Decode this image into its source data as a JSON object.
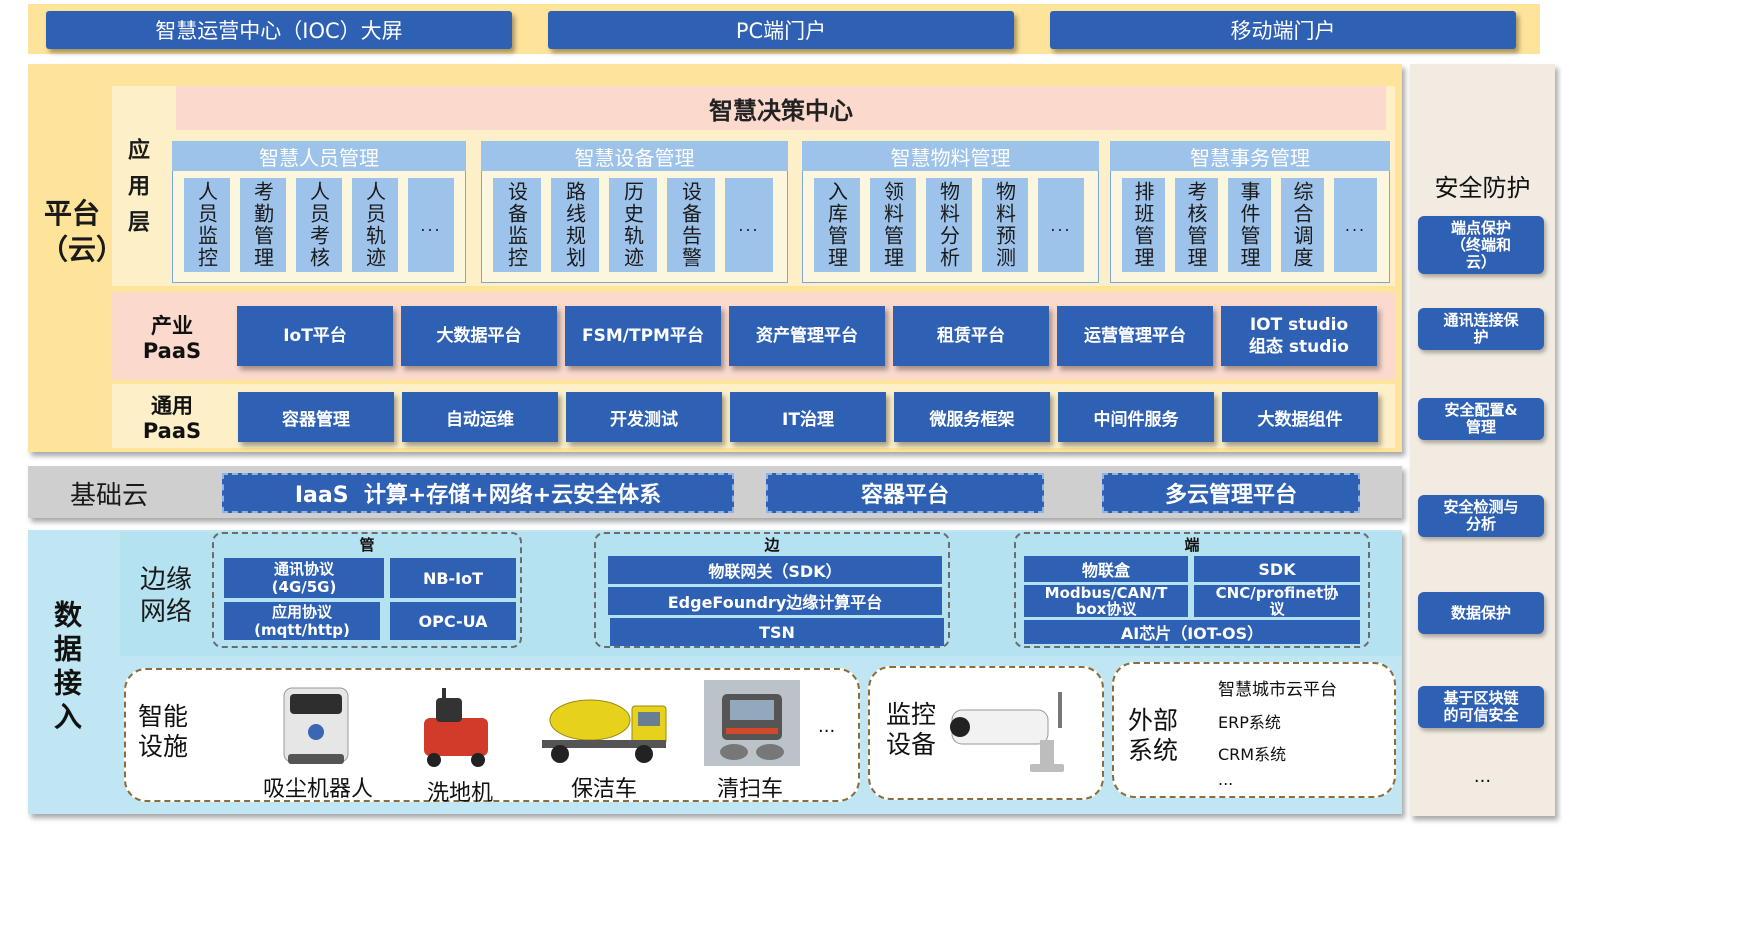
{
  "portals": [
    "智慧运营中心（IOC）大屏",
    "PC端门户",
    "移动端门户"
  ],
  "platform": {
    "label": "平台（云）",
    "decision_center": "智慧决策中心",
    "app_layer_label": "应用层",
    "groups": [
      {
        "title": "智慧人员管理",
        "items": [
          "人员监控",
          "考勤管理",
          "人员考核",
          "人员轨迹",
          "..."
        ]
      },
      {
        "title": "智慧设备管理",
        "items": [
          "设备监控",
          "路线规划",
          "历史轨迹",
          "设备告警",
          "..."
        ]
      },
      {
        "title": "智慧物料管理",
        "items": [
          "入库管理",
          "领料管理",
          "物料分析",
          "物料预测",
          "..."
        ]
      },
      {
        "title": "智慧事务管理",
        "items": [
          "排班管理",
          "考核管理",
          "事件管理",
          "综合调度",
          "..."
        ]
      }
    ],
    "industry_paas": {
      "label_line1": "产业",
      "label_line2": "PaaS",
      "items": [
        "IoT平台",
        "大数据平台",
        "FSM/TPM平台",
        "资产管理平台",
        "租赁平台",
        "运营管理平台",
        "IOT studio\n组态 studio"
      ]
    },
    "general_paas": {
      "label_line1": "通用",
      "label_line2": "PaaS",
      "items": [
        "容器管理",
        "自动运维",
        "开发测试",
        "IT治理",
        "微服务框架",
        "中间件服务",
        "大数据组件"
      ]
    }
  },
  "base_cloud": {
    "label": "基础云",
    "items": [
      "IaaS  计算+存储+网络+云安全体系",
      "容器平台",
      "多云管理平台"
    ]
  },
  "data_access": {
    "label": "数据接入",
    "edge_network_label": "边缘网络",
    "pipe": {
      "title": "管",
      "items": [
        "通讯协议\n(4G/5G)",
        "NB-IoT",
        "应用协议\n(mqtt/http)",
        "OPC-UA"
      ]
    },
    "edge": {
      "title": "边",
      "items": [
        "物联网关（SDK）",
        "EdgeFoundry边缘计算平台",
        "TSN"
      ]
    },
    "end": {
      "title": "端",
      "items": [
        "物联盒",
        "SDK",
        "Modbus/CAN/T\nbox协议",
        "CNC/profinet协\n议",
        "AI芯片（IOT-OS）"
      ]
    },
    "smart_facility": {
      "label": "智能设施",
      "items": [
        "吸尘机器人",
        "洗地机",
        "保洁车",
        "清扫车"
      ],
      "more": "..."
    },
    "monitor": {
      "label": "监控设备"
    },
    "external": {
      "label": "外部系统",
      "items": [
        "智慧城市云平台",
        "ERP系统",
        "CRM系统",
        "..."
      ]
    }
  },
  "security": {
    "title": "安全防护",
    "items": [
      "端点保护\n（终端和\n云）",
      "通讯连接保\n护",
      "安全配置&\n管理",
      "安全检测与\n分析",
      "数据保护",
      "基于区块链\n的可信安全"
    ],
    "more": "..."
  },
  "colors": {
    "primary_blue": "#2e60b4",
    "light_blue": "#9ec3ea",
    "platform_yellow": "#fde49a",
    "data_cyan": "#bfe6f2"
  }
}
